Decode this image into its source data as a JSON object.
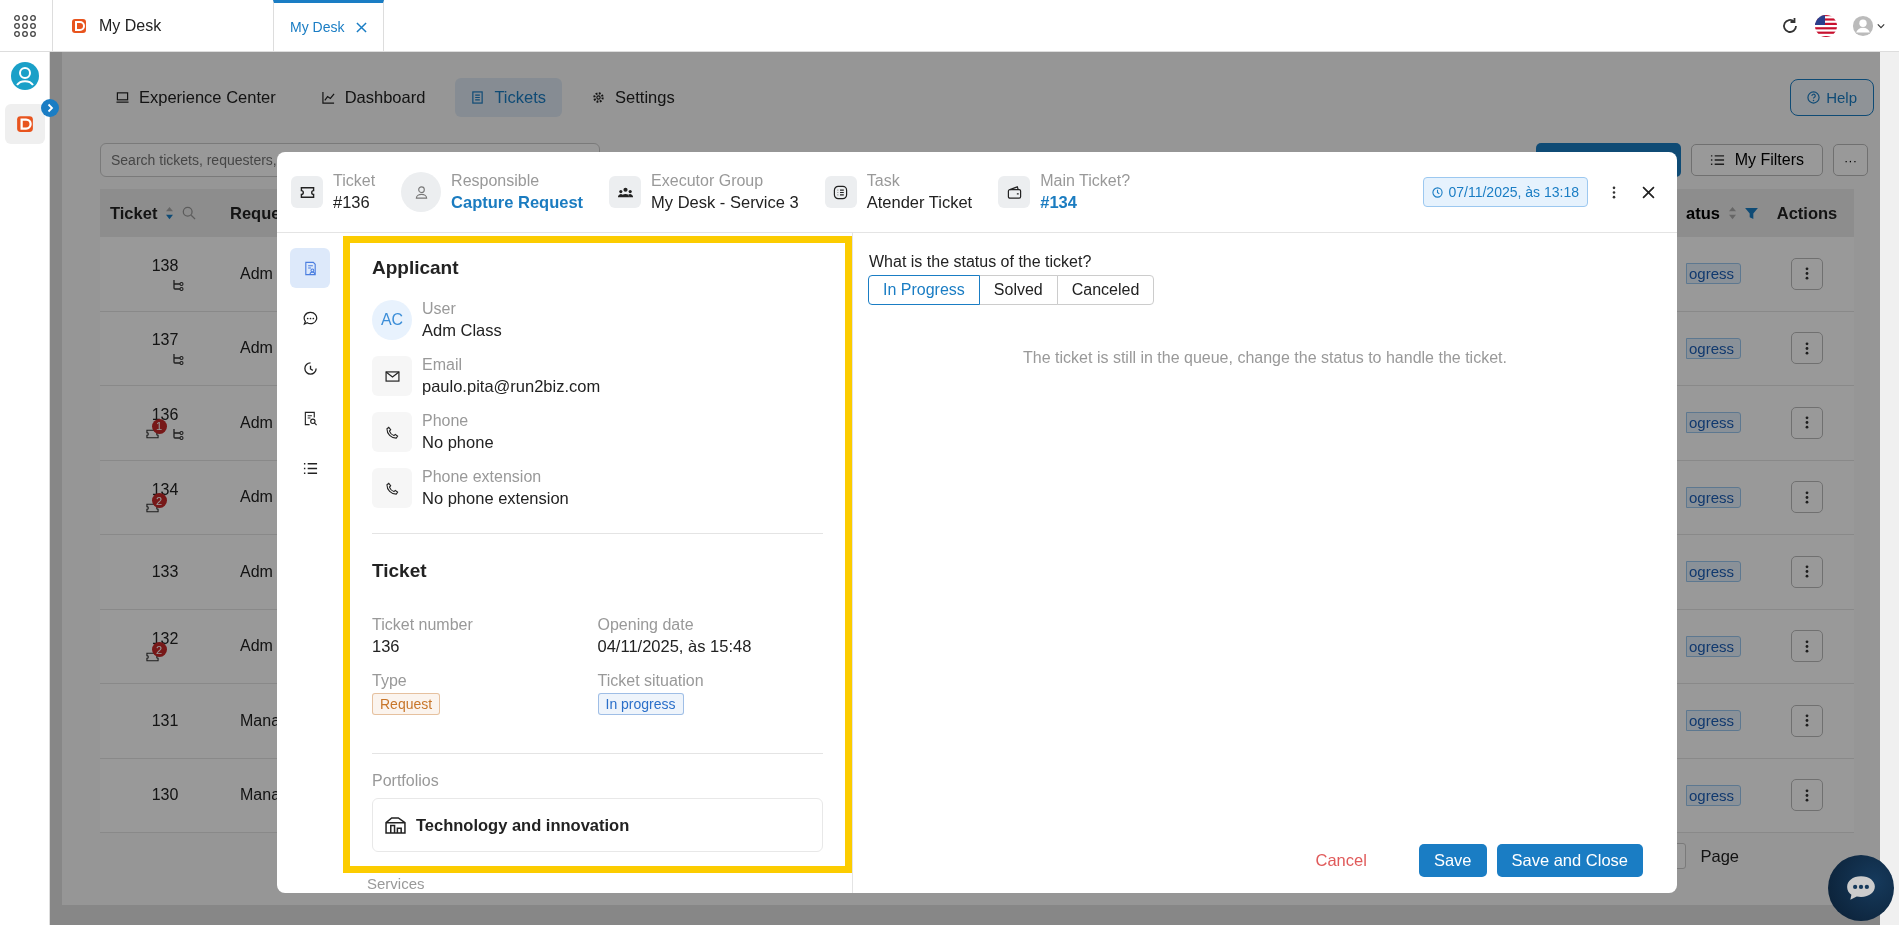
{
  "top_bar": {
    "app_title": "My Desk",
    "tabs": [
      {
        "label": "My Desk",
        "selected": true
      }
    ]
  },
  "nav": {
    "tabs": [
      {
        "label": "Experience Center",
        "kind": "monitor",
        "selected": false
      },
      {
        "label": "Dashboard",
        "kind": "chart",
        "selected": false
      },
      {
        "label": "Tickets",
        "kind": "list",
        "selected": true
      },
      {
        "label": "Settings",
        "kind": "gear",
        "selected": false
      }
    ],
    "help_button": "Help"
  },
  "toolbar": {
    "search_placeholder": "Search tickets, requesters,",
    "filters_button": "My Filters",
    "more_button": "···"
  },
  "table": {
    "columns": [
      "Ticket",
      "Reque",
      "atus",
      "Actions"
    ],
    "rows": [
      {
        "ticket": "138",
        "requester": "Adm",
        "status": "ogress",
        "linked_count": null,
        "branched": true
      },
      {
        "ticket": "137",
        "requester": "Adm",
        "status": "ogress",
        "linked_count": null,
        "branched": true
      },
      {
        "ticket": "136",
        "requester": "Adm",
        "status": "ogress",
        "linked_count": "1",
        "branched": true
      },
      {
        "ticket": "134",
        "requester": "Adm",
        "status": "ogress",
        "linked_count": "2",
        "branched": false
      },
      {
        "ticket": "133",
        "requester": "Adm",
        "status": "ogress",
        "linked_count": null,
        "branched": false
      },
      {
        "ticket": "132",
        "requester": "Adm",
        "status": "ogress",
        "linked_count": "2",
        "branched": false
      },
      {
        "ticket": "131",
        "requester": "Mana",
        "status": "ogress",
        "linked_count": null,
        "branched": false
      },
      {
        "ticket": "130",
        "requester": "Mana",
        "status": "ogress",
        "linked_count": null,
        "branched": false
      }
    ],
    "page_label": "Page"
  },
  "modal": {
    "header": [
      {
        "kind": "ticket",
        "label": "Ticket",
        "value": "#136",
        "link": false
      },
      {
        "kind": "person",
        "label": "Responsible",
        "value": "Capture Request",
        "link": true
      },
      {
        "kind": "group",
        "label": "Executor Group",
        "value": "My Desk - Service 3",
        "link": false
      },
      {
        "kind": "task",
        "label": "Task",
        "value": "Atender Ticket",
        "link": false
      },
      {
        "kind": "wallet",
        "label": "Main Ticket?",
        "value": "#134",
        "link": true
      }
    ],
    "date": "07/11/2025, às 13:18",
    "side_tabs": [
      {
        "kind": "details",
        "selected": true
      },
      {
        "kind": "chat",
        "selected": false
      },
      {
        "kind": "history",
        "selected": false
      },
      {
        "kind": "search-doc",
        "selected": false
      },
      {
        "kind": "list",
        "selected": false
      }
    ],
    "applicant": {
      "title": "Applicant",
      "user": {
        "initials": "AC",
        "label": "User",
        "value": "Adm Class"
      },
      "contacts": [
        {
          "kind": "email",
          "label": "Email",
          "value": "paulo.pita@run2biz.com"
        },
        {
          "kind": "phone",
          "label": "Phone",
          "value": "No phone"
        },
        {
          "kind": "phone",
          "label": "Phone extension",
          "value": "No phone extension"
        }
      ]
    },
    "ticket": {
      "title": "Ticket",
      "fields": [
        {
          "kind": "text",
          "label": "Ticket number",
          "value": "136"
        },
        {
          "kind": "text",
          "label": "Opening date",
          "value": "04/11/2025, às 15:48"
        },
        {
          "kind": "tag",
          "label": "Type",
          "value": "Request",
          "color": "#c8762a"
        },
        {
          "kind": "tag",
          "label": "Ticket situation",
          "value": "In progress",
          "color": "#2a6fc9"
        }
      ]
    },
    "portfolios": {
      "label": "Portfolios",
      "item": "Technology and innovation"
    },
    "services_label": "Services",
    "status_question": "What is the status of the ticket?",
    "status_options": [
      {
        "label": "In Progress",
        "selected": true
      },
      {
        "label": "Solved",
        "selected": false
      },
      {
        "label": "Canceled",
        "selected": false
      }
    ],
    "message": "The ticket is still in the queue, change the status to handle the ticket.",
    "buttons": {
      "cancel": "Cancel",
      "save": "Save",
      "save_close": "Save and Close"
    }
  }
}
